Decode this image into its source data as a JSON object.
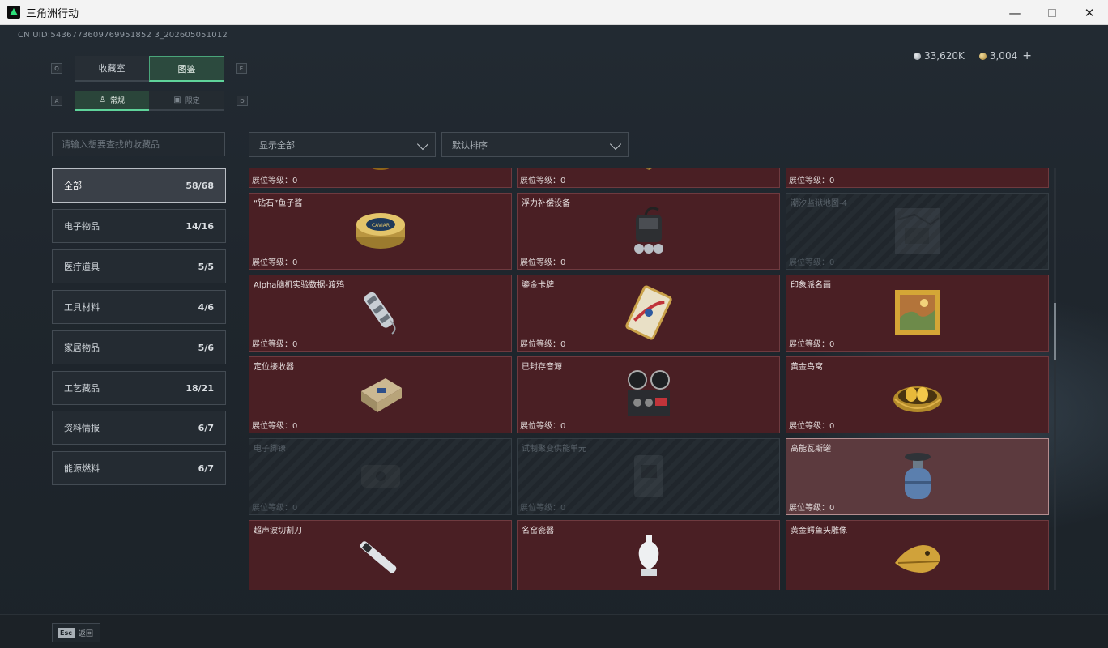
{
  "window": {
    "title": "三角洲行动",
    "controls": {
      "minimize": "—",
      "close": "✕"
    }
  },
  "header": {
    "uid": "CN UID:5436773609769951852 3_202605051012",
    "silver_amount": "33,620K",
    "gold_amount": "3,004",
    "add_symbol": "+"
  },
  "tabs": {
    "prev_key": "Q",
    "next_key": "E",
    "collection": "收藏室",
    "atlas": "图鉴"
  },
  "subtabs": {
    "prev_key": "A",
    "next_key": "D",
    "normal": "常规",
    "limited": "限定"
  },
  "search": {
    "placeholder": "请输入想要查找的收藏品"
  },
  "categories": [
    {
      "label": "全部",
      "count": "58/68"
    },
    {
      "label": "电子物品",
      "count": "14/16"
    },
    {
      "label": "医疗道具",
      "count": "5/5"
    },
    {
      "label": "工具材料",
      "count": "4/6"
    },
    {
      "label": "家居物品",
      "count": "5/6"
    },
    {
      "label": "工艺藏品",
      "count": "18/21"
    },
    {
      "label": "资料情报",
      "count": "6/7"
    },
    {
      "label": "能源燃料",
      "count": "6/7"
    }
  ],
  "filters": {
    "show": "显示全部",
    "sort": "默认排序"
  },
  "grid": {
    "cards": [
      {
        "name": "",
        "level": "展位等级：0",
        "icon": "armillary-sphere-icon",
        "state": "owned"
      },
      {
        "name": "",
        "level": "展位等级：0",
        "icon": "chess-board-icon",
        "state": "owned"
      },
      {
        "name": "",
        "level": "展位等级：0",
        "icon": "generator-icon",
        "state": "owned"
      },
      {
        "name": "“钻石”鱼子酱",
        "level": "展位等级：0",
        "icon": "caviar-tin-icon",
        "state": "owned"
      },
      {
        "name": "浮力补偿设备",
        "level": "展位等级：0",
        "icon": "buoyancy-device-icon",
        "state": "owned"
      },
      {
        "name": "潮汐监狱地图-4",
        "level": "展位等级：0",
        "icon": "map-icon",
        "state": "locked"
      },
      {
        "name": "Alpha脑机实验数据-渡鸦",
        "level": "展位等级：0",
        "icon": "data-canister-icon",
        "state": "owned"
      },
      {
        "name": "鎏金卡牌",
        "level": "展位等级：0",
        "icon": "gilded-card-icon",
        "state": "owned"
      },
      {
        "name": "印象派名画",
        "level": "展位等级：0",
        "icon": "painting-icon",
        "state": "owned"
      },
      {
        "name": "定位接收器",
        "level": "展位等级：0",
        "icon": "receiver-icon",
        "state": "owned"
      },
      {
        "name": "已封存音源",
        "level": "展位等级：0",
        "icon": "reel-recorder-icon",
        "state": "owned"
      },
      {
        "name": "黄金鸟窝",
        "level": "展位等级：0",
        "icon": "golden-nest-icon",
        "state": "owned"
      },
      {
        "name": "电子脚镣",
        "level": "展位等级：0",
        "icon": "ankle-monitor-icon",
        "state": "locked"
      },
      {
        "name": "试制聚变供能单元",
        "level": "展位等级：0",
        "icon": "fusion-cell-icon",
        "state": "locked"
      },
      {
        "name": "高能瓦斯罐",
        "level": "展位等级：0",
        "icon": "gas-canister-icon",
        "state": "highlight"
      },
      {
        "name": "超声波切割刀",
        "level": "",
        "icon": "ultrasonic-cutter-icon",
        "state": "owned"
      },
      {
        "name": "名窑瓷器",
        "level": "",
        "icon": "porcelain-icon",
        "state": "owned"
      },
      {
        "name": "黄金鳄鱼头雕像",
        "level": "",
        "icon": "golden-croc-icon",
        "state": "owned"
      }
    ]
  },
  "bottom": {
    "esc_key": "Esc",
    "back_label": "返回"
  },
  "colors": {
    "accent_green": "#5fd39a",
    "owned_card": "#4a1f24",
    "locked_card": "#252c32"
  }
}
